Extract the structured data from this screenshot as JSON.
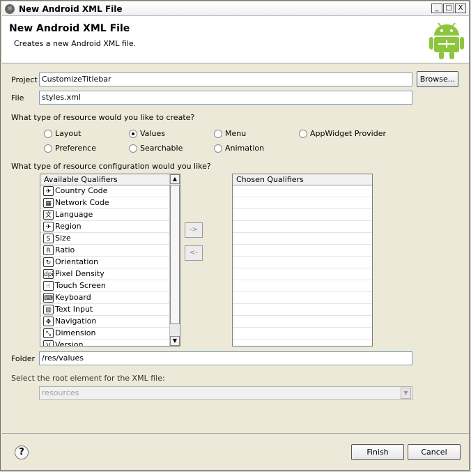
{
  "window": {
    "title": "New Android XML File",
    "icon": "eclipse-icon",
    "controls": [
      "_",
      "□",
      "X"
    ]
  },
  "header": {
    "title": "New Android XML File",
    "subtitle": "Creates a new Android XML file.",
    "logo": "android-robot-icon"
  },
  "project": {
    "label": "Project",
    "value": "CustomizeTitlebar",
    "browse_label": "Browse..."
  },
  "file": {
    "label": "File",
    "value": "styles.xml"
  },
  "resource_type": {
    "question": "What type of resource would you like to create?",
    "options": [
      {
        "label": "Layout",
        "selected": false
      },
      {
        "label": "Values",
        "selected": true
      },
      {
        "label": "Menu",
        "selected": false
      },
      {
        "label": "AppWidget Provider",
        "selected": false
      },
      {
        "label": "Preference",
        "selected": false
      },
      {
        "label": "Searchable",
        "selected": false
      },
      {
        "label": "Animation",
        "selected": false
      }
    ]
  },
  "config": {
    "question": "What type of resource configuration would you like?",
    "available_header": "Available Qualifiers",
    "chosen_header": "Chosen Qualifiers",
    "available": [
      {
        "label": "Country Code",
        "icon": "globe-icon",
        "glyph": "✈"
      },
      {
        "label": "Network Code",
        "icon": "network-icon",
        "glyph": "▦"
      },
      {
        "label": "Language",
        "icon": "language-icon",
        "glyph": "文"
      },
      {
        "label": "Region",
        "icon": "region-icon",
        "glyph": "✈"
      },
      {
        "label": "Size",
        "icon": "size-icon",
        "glyph": "S"
      },
      {
        "label": "Ratio",
        "icon": "ratio-icon",
        "glyph": "R"
      },
      {
        "label": "Orientation",
        "icon": "orientation-icon",
        "glyph": "↻"
      },
      {
        "label": "Pixel Density",
        "icon": "dpi-icon",
        "glyph": "dpi"
      },
      {
        "label": "Touch Screen",
        "icon": "touch-screen-icon",
        "glyph": "☝"
      },
      {
        "label": "Keyboard",
        "icon": "keyboard-icon",
        "glyph": "⌨"
      },
      {
        "label": "Text Input",
        "icon": "text-input-icon",
        "glyph": "▥"
      },
      {
        "label": "Navigation",
        "icon": "navigation-icon",
        "glyph": "✥"
      },
      {
        "label": "Dimension",
        "icon": "dimension-icon",
        "glyph": "⤡"
      },
      {
        "label": "Version",
        "icon": "version-icon",
        "glyph": "V"
      }
    ],
    "add_label": "->",
    "remove_label": "<-"
  },
  "folder": {
    "label": "Folder",
    "value": "/res/values"
  },
  "root_element": {
    "label": "Select the root element for the XML file:",
    "value": "resources"
  },
  "footer": {
    "help": "?",
    "finish_label": "Finish",
    "cancel_label": "Cancel"
  }
}
